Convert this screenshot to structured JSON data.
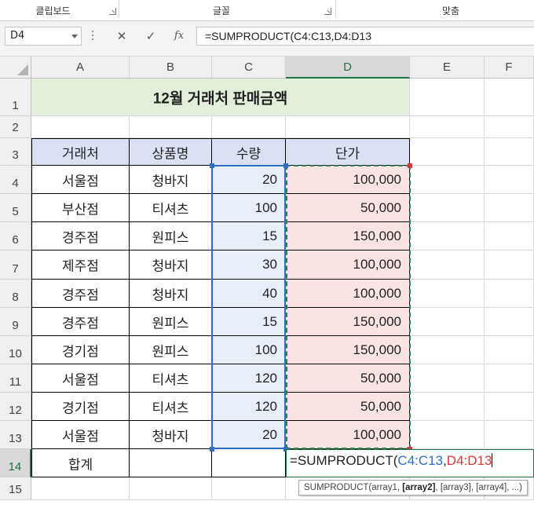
{
  "ribbon": {
    "groups": [
      "클립보드",
      "글꼴",
      "맞춤"
    ]
  },
  "formula_bar": {
    "name_box": "D4",
    "cancel_icon": "✕",
    "enter_icon": "✓",
    "fx_label": "fx",
    "formula": "=SUMPRODUCT(C4:C13,D4:D13"
  },
  "columns": [
    "A",
    "B",
    "C",
    "D",
    "E",
    "F"
  ],
  "rows": [
    "1",
    "2",
    "3",
    "4",
    "5",
    "6",
    "7",
    "8",
    "9",
    "10",
    "11",
    "12",
    "13",
    "14",
    "15"
  ],
  "sheet": {
    "title": "12월 거래처 판매금액",
    "headers": [
      "거래처",
      "상품명",
      "수량",
      "단가"
    ],
    "data": [
      [
        "서울점",
        "청바지",
        "20",
        "100,000"
      ],
      [
        "부산점",
        "티셔츠",
        "100",
        "50,000"
      ],
      [
        "경주점",
        "원피스",
        "15",
        "150,000"
      ],
      [
        "제주점",
        "청바지",
        "30",
        "100,000"
      ],
      [
        "경주점",
        "청바지",
        "40",
        "100,000"
      ],
      [
        "경주점",
        "원피스",
        "15",
        "150,000"
      ],
      [
        "경기점",
        "원피스",
        "100",
        "150,000"
      ],
      [
        "서울점",
        "티셔츠",
        "120",
        "50,000"
      ],
      [
        "경기점",
        "티셔츠",
        "120",
        "50,000"
      ],
      [
        "서울점",
        "청바지",
        "20",
        "100,000"
      ]
    ],
    "total_label": "합계"
  },
  "editing": {
    "prefix": "=SUMPRODUCT(",
    "ref1": "C4:C13",
    "comma": ",",
    "ref2": "D4:D13"
  },
  "tooltip": {
    "pre": "SUMPRODUCT(array1, ",
    "bold": "[array2]",
    "post": ", [array3], [array4], ...)"
  },
  "colors": {
    "title_fill": "#e2efda",
    "header_fill": "#d9e1f2",
    "range1": "#2e6fc1",
    "range2": "#d8363a",
    "excel_green": "#217346"
  }
}
